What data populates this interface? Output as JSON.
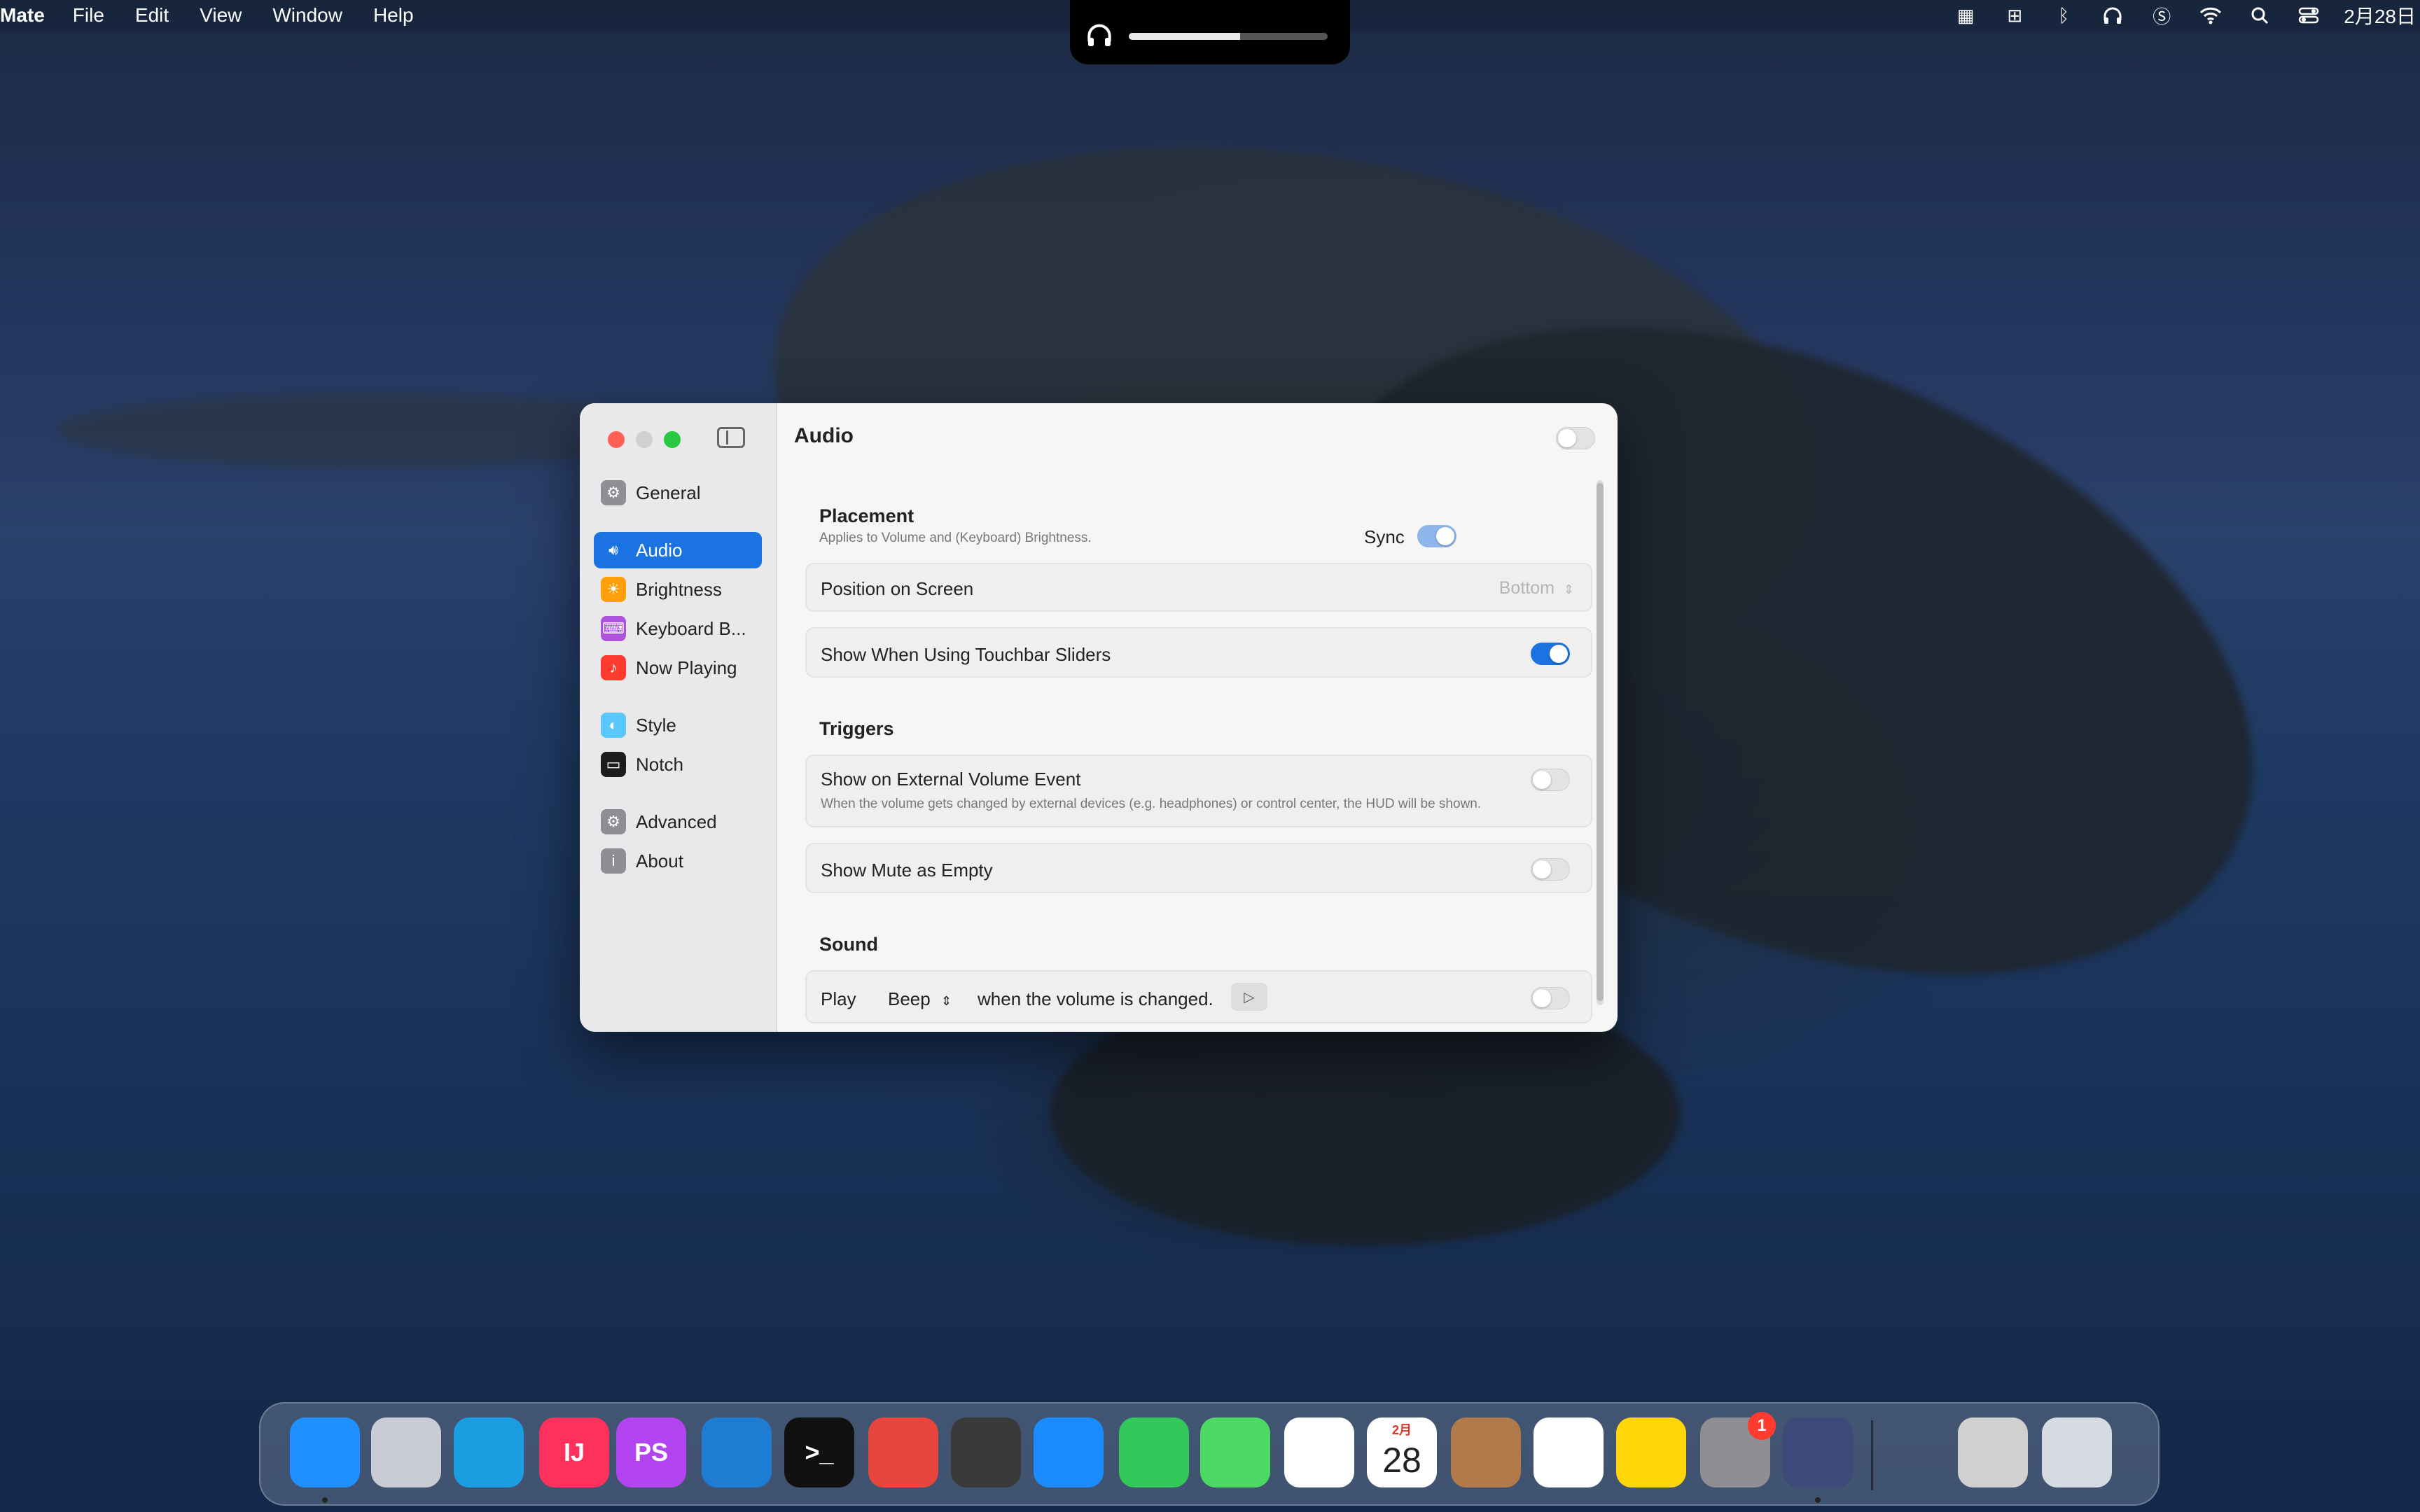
{
  "menubar": {
    "app_name": "Mate",
    "items": [
      "File",
      "Edit",
      "View",
      "Window",
      "Help"
    ],
    "status_icons": [
      "grid-icon",
      "input-method-icon",
      "bluetooth-icon",
      "headphones-icon",
      "shortcut-s-icon",
      "wifi-icon",
      "search-icon",
      "control-center-icon"
    ],
    "clock": "2月28日"
  },
  "hud": {
    "icon": "headphones-icon",
    "volume_level": 0.56
  },
  "window": {
    "sidebar": {
      "items": [
        {
          "label": "General",
          "icon": "gear-icon",
          "color": "#8e8e93"
        },
        {
          "label": "Audio",
          "icon": "speaker-icon",
          "color": "#1a73e0",
          "active": true
        },
        {
          "label": "Brightness",
          "icon": "sun-icon",
          "color": "#ff9f0a"
        },
        {
          "label": "Keyboard B...",
          "icon": "keyboard-icon",
          "color": "#af52de"
        },
        {
          "label": "Now Playing",
          "icon": "music-note-icon",
          "color": "#ff3b30"
        },
        {
          "label": "Style",
          "icon": "palette-icon",
          "color": "#5ac8fa"
        },
        {
          "label": "Notch",
          "icon": "display-icon",
          "color": "#1c1c1e"
        },
        {
          "label": "Advanced",
          "icon": "gears-icon",
          "color": "#8e8e93"
        },
        {
          "label": "About",
          "icon": "info-icon",
          "color": "#8e8e93"
        }
      ]
    },
    "content": {
      "title": "Audio",
      "master_toggle": false,
      "placement": {
        "heading": "Placement",
        "subtitle": "Applies to Volume and (Keyboard) Brightness.",
        "sync_label": "Sync",
        "sync": true,
        "position_label": "Position on Screen",
        "position_value": "Bottom",
        "touchbar_label": "Show When Using Touchbar Sliders",
        "touchbar": true
      },
      "triggers": {
        "heading": "Triggers",
        "external_label": "Show on External Volume Event",
        "external_desc": "When the volume gets changed by external devices (e.g. headphones) or control center, the HUD will be shown.",
        "external": false,
        "mute_label": "Show Mute as Empty",
        "mute": false
      },
      "sound": {
        "heading": "Sound",
        "play_label": "Play",
        "sound_value": "Beep",
        "suffix": "when the volume is changed.",
        "enabled": false
      }
    }
  },
  "dock": {
    "apps": [
      {
        "name": "finder-icon",
        "label": "",
        "color": "#1e90ff",
        "running": true
      },
      {
        "name": "launchpad-icon",
        "label": "",
        "color": "#c9ccd4"
      },
      {
        "name": "edge-icon",
        "label": "",
        "color": "#1b9de2"
      },
      {
        "name": "intellij-icon",
        "label": "IJ",
        "color": "#fe315d"
      },
      {
        "name": "phpstorm-icon",
        "label": "PS",
        "color": "#b345f1"
      },
      {
        "name": "vscode-icon",
        "label": "",
        "color": "#1f7cd3"
      },
      {
        "name": "terminal-icon",
        "label": ">_",
        "color": "#111111"
      },
      {
        "name": "chrome-icon",
        "label": "",
        "color": "#e8453c"
      },
      {
        "name": "calculator-icon",
        "label": "",
        "color": "#3a3a3c"
      },
      {
        "name": "app-store-icon",
        "label": "",
        "color": "#1a8cff"
      },
      {
        "name": "messages-icon",
        "label": "",
        "color": "#34c759"
      },
      {
        "name": "maps-icon",
        "label": "",
        "color": "#4cd964"
      },
      {
        "name": "photos-icon",
        "label": "",
        "color": "#ffffff"
      },
      {
        "name": "calendar-icon",
        "label": "28",
        "month": "2月",
        "color": "#ffffff"
      },
      {
        "name": "contacts-icon",
        "label": "",
        "color": "#b07a4a"
      },
      {
        "name": "reminders-icon",
        "label": "",
        "color": "#ffffff"
      },
      {
        "name": "notes-icon",
        "label": "",
        "color": "#ffd60a"
      },
      {
        "name": "system-settings-icon",
        "label": "",
        "color": "#8e8e93",
        "badge": "1"
      },
      {
        "name": "mate-icon",
        "label": "",
        "color": "#3c4a7a",
        "running": true
      },
      {
        "name": "preview-icon",
        "label": "",
        "color": "#d0d0d0"
      },
      {
        "name": "trash-icon",
        "label": "",
        "color": "#d6dbe2"
      }
    ]
  }
}
